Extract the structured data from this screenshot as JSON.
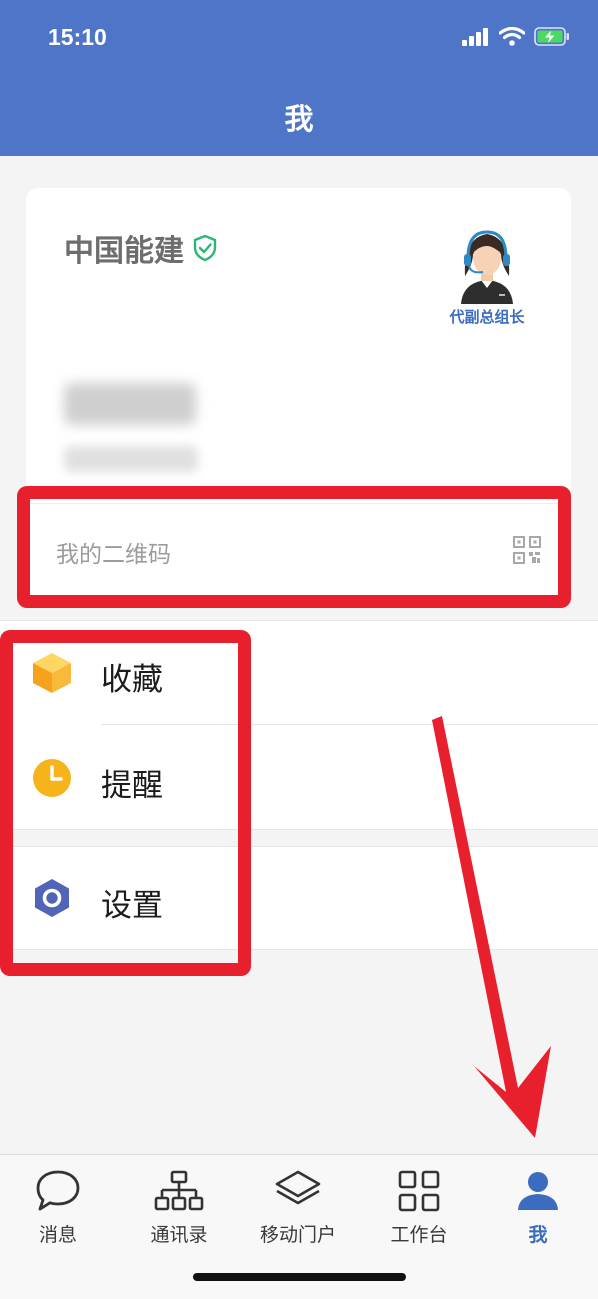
{
  "status": {
    "time": "15:10"
  },
  "header": {
    "title": "我"
  },
  "profile": {
    "company": "中国能建",
    "role_tag": "代副总组长",
    "qr_label": "我的二维码"
  },
  "menu": {
    "favorites": "收藏",
    "reminders": "提醒",
    "settings": "设置"
  },
  "tabs": [
    "消息",
    "通讯录",
    "移动门户",
    "工作台",
    "我"
  ],
  "colors": {
    "header_bg": "#4f75c8",
    "accent": "#3b6cc0",
    "annotation_red": "#e8202e",
    "verified_green": "#2bb673"
  }
}
